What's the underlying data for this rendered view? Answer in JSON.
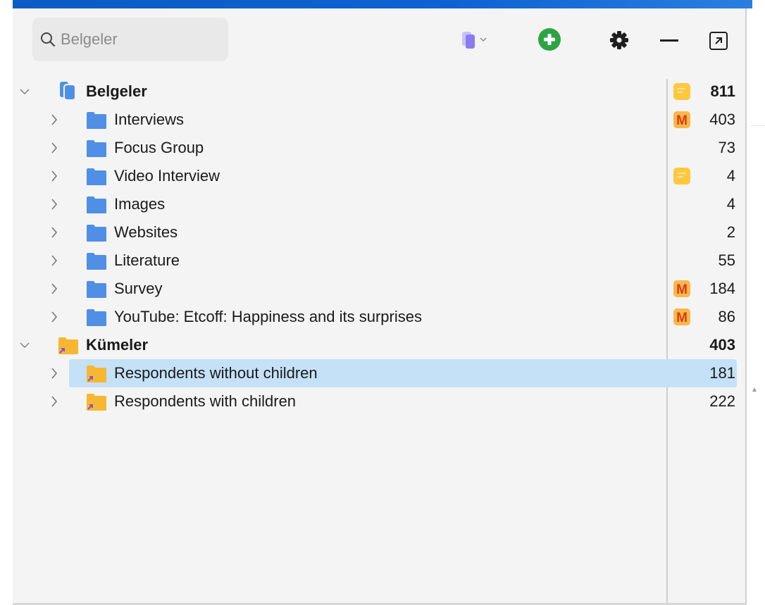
{
  "search": {
    "placeholder": "Belgeler",
    "value": ""
  },
  "toolbar": {
    "doc_menu_icon": "document-stack-icon",
    "add_icon": "plus-circle-icon",
    "settings_icon": "gear-icon",
    "minimize_icon": "minus-icon",
    "popout_icon": "open-external-icon"
  },
  "colors": {
    "selection": "#c5e1f7",
    "folder_blue": "#4f8fe6",
    "set_orange": "#f7b731",
    "memo_yellow": "#ffc83d",
    "m_badge_bg": "#f9b84a",
    "m_badge_fg": "#d93b16",
    "add_green": "#2ea343",
    "doc_purple": "#8a7cf0",
    "accent_bar": "#0b5cc4"
  },
  "tree": {
    "documents_root": {
      "label": "Belgeler",
      "count": "811",
      "badge": "memo",
      "expanded": true
    },
    "document_groups": [
      {
        "label": "Interviews",
        "count": "403",
        "badge": "M"
      },
      {
        "label": "Focus Group",
        "count": "73",
        "badge": ""
      },
      {
        "label": "Video Interview",
        "count": "4",
        "badge": "memo"
      },
      {
        "label": "Images",
        "count": "4",
        "badge": ""
      },
      {
        "label": "Websites",
        "count": "2",
        "badge": ""
      },
      {
        "label": "Literature",
        "count": "55",
        "badge": ""
      },
      {
        "label": "Survey",
        "count": "184",
        "badge": "M"
      },
      {
        "label": "YouTube: Etcoff: Happiness and its surprises",
        "count": "86",
        "badge": "M"
      }
    ],
    "sets_root": {
      "label": "Kümeler",
      "count": "403",
      "expanded": true
    },
    "sets": [
      {
        "label": "Respondents without children",
        "count": "181",
        "selected": true
      },
      {
        "label": "Respondents with children",
        "count": "222",
        "selected": false
      }
    ]
  }
}
